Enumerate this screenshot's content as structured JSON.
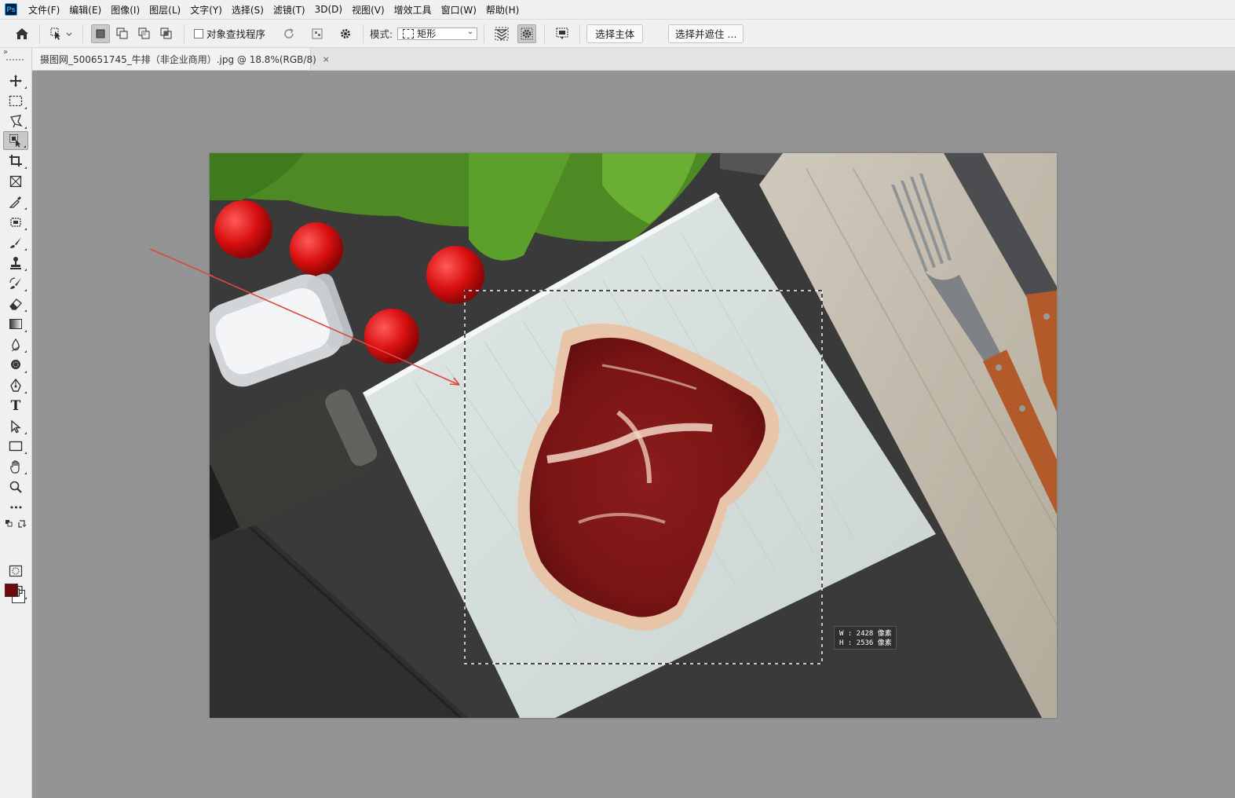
{
  "menubar": {
    "app_icon_text": "Ps",
    "items": [
      "文件(F)",
      "编辑(E)",
      "图像(I)",
      "图层(L)",
      "文字(Y)",
      "选择(S)",
      "滤镜(T)",
      "3D(D)",
      "视图(V)",
      "增效工具",
      "窗口(W)",
      "帮助(H)"
    ]
  },
  "options": {
    "object_finder_label": "对象查找程序",
    "mode_label": "模式:",
    "mode_value": "矩形",
    "select_subject_label": "选择主体",
    "select_and_mask_label": "选择并遮住 ..."
  },
  "document": {
    "tab_title": "摄图网_500651745_牛排（非企业商用）.jpg @ 18.8%(RGB/8)",
    "close_glyph": "×"
  },
  "toolbar": {
    "collapse_glyph": "»",
    "foreground_color": "#6e0a0a",
    "background_color": "#ffffff",
    "tools": [
      "move-tool",
      "marquee-tool",
      "lasso-tool",
      "object-selection-tool",
      "crop-tool",
      "frame-tool",
      "eyedropper-tool",
      "healing-brush-tool",
      "brush-tool",
      "stamp-tool",
      "history-brush-tool",
      "eraser-tool",
      "gradient-tool",
      "blur-tool",
      "dodge-tool",
      "pen-tool",
      "type-tool",
      "path-selection-tool",
      "rectangle-tool",
      "hand-tool",
      "zoom-tool",
      "more-tools"
    ],
    "type_tool_glyph": "T",
    "more_glyph": "•••"
  },
  "selection": {
    "width_readout": "W :  2428 像素",
    "height_readout": "H :  2536 像素"
  }
}
